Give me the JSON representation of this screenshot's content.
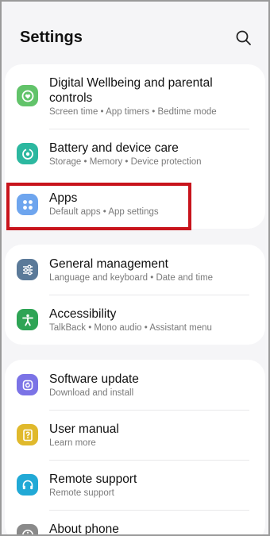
{
  "header": {
    "title": "Settings"
  },
  "colors": {
    "highlight": "#c8141c",
    "wellbeing": "#62c36a",
    "battery": "#2cb8a0",
    "apps": "#6ea5ee",
    "general": "#5b7a99",
    "accessibility": "#2ea455",
    "software": "#7b73e6",
    "manual": "#e0b92c",
    "remote": "#21a9d6"
  },
  "groups": [
    {
      "items": [
        {
          "title_line1": "Digital Wellbeing and parental",
          "title_line2": "controls",
          "subtitle": "Screen time  •  App timers  •  Bedtime mode",
          "icon": "wellbeing-icon"
        },
        {
          "title": "Battery and device care",
          "subtitle": "Storage  •  Memory  •  Device protection",
          "icon": "battery-care-icon"
        },
        {
          "title": "Apps",
          "subtitle": "Default apps  •  App settings",
          "icon": "apps-icon"
        }
      ]
    },
    {
      "items": [
        {
          "title": "General management",
          "subtitle": "Language and keyboard  •  Date and time",
          "icon": "sliders-icon"
        },
        {
          "title": "Accessibility",
          "subtitle": "TalkBack  •  Mono audio  •  Assistant menu",
          "icon": "accessibility-icon"
        }
      ]
    },
    {
      "items": [
        {
          "title": "Software update",
          "subtitle": "Download and install",
          "icon": "software-update-icon"
        },
        {
          "title": "User manual",
          "subtitle": "Learn more",
          "icon": "user-manual-icon"
        },
        {
          "title": "Remote support",
          "subtitle": "Remote support",
          "icon": "headset-icon"
        },
        {
          "title": "About phone",
          "icon": "info-icon"
        }
      ]
    }
  ]
}
